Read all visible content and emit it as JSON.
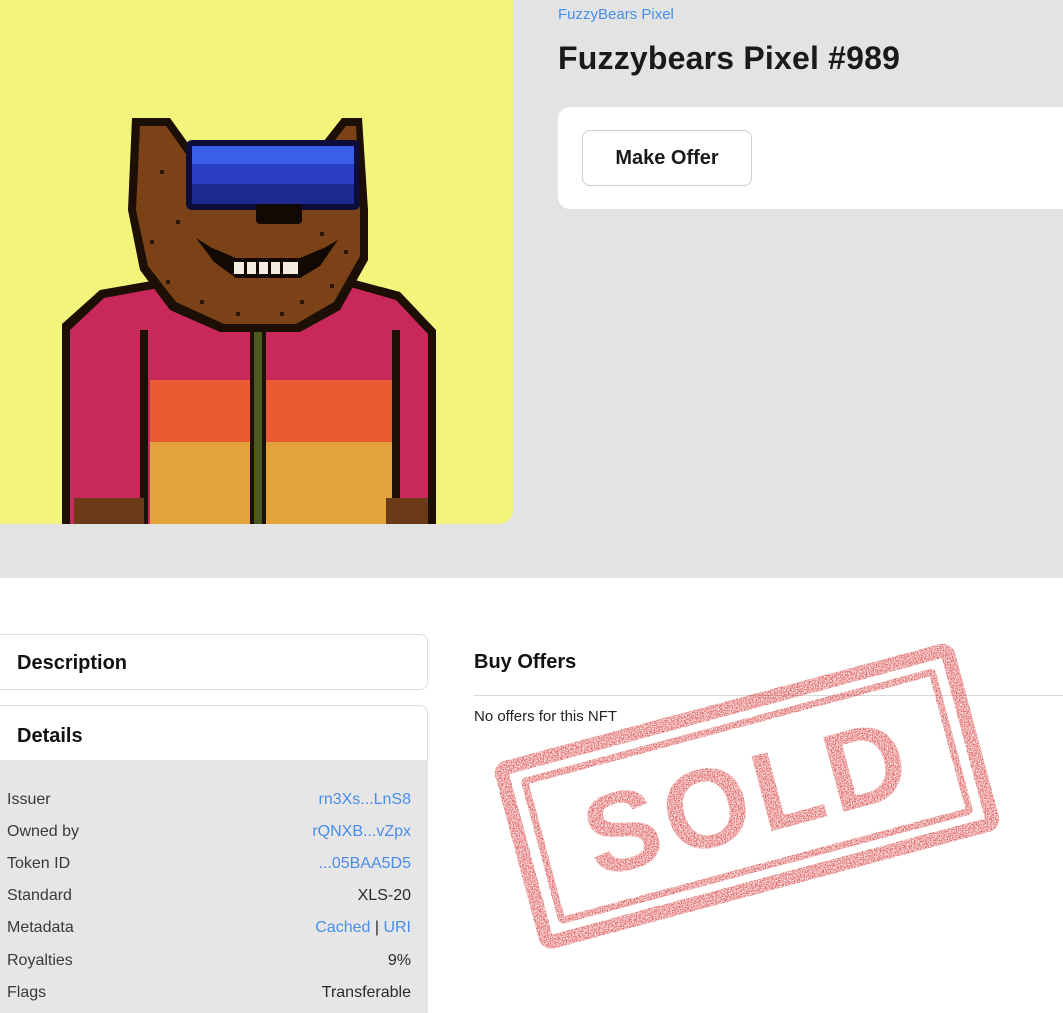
{
  "collection": {
    "name": "FuzzyBears Pixel"
  },
  "nft": {
    "title": "Fuzzybears Pixel #989"
  },
  "actions": {
    "make_offer": "Make Offer"
  },
  "panels": {
    "description": "Description",
    "details": "Details"
  },
  "details": [
    {
      "key": "Issuer",
      "value": "rn3Xs...LnS8",
      "link": true
    },
    {
      "key": "Owned by",
      "value": "rQNXB...vZpx",
      "link": true
    },
    {
      "key": "Token ID",
      "value": "...05BAA5D5",
      "link": true
    },
    {
      "key": "Standard",
      "value": "XLS-20",
      "link": false
    },
    {
      "key": "Metadata",
      "value_parts": [
        "Cached",
        " | ",
        "URI"
      ]
    },
    {
      "key": "Royalties",
      "value": "9%",
      "link": false
    },
    {
      "key": "Flags",
      "value": "Transferable",
      "link": false
    }
  ],
  "buy_offers": {
    "title": "Buy Offers",
    "empty_text": "No offers for this NFT"
  },
  "stamp": {
    "text": "SOLD",
    "color": "#d42a2a"
  },
  "colors": {
    "accent_link": "#4a8ee8",
    "image_background": "#f3f47c",
    "band_background": "#e3e3e3"
  }
}
